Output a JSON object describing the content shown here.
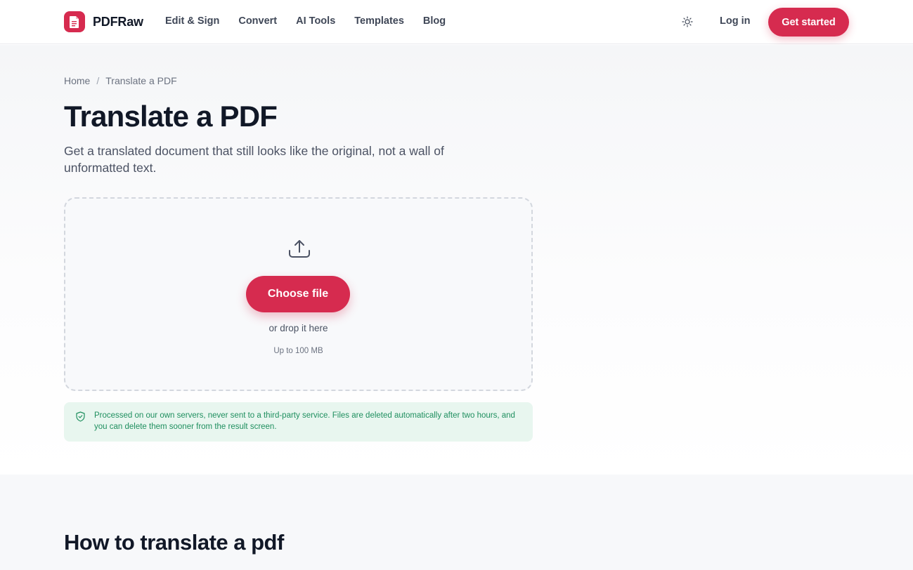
{
  "brand": {
    "name": "PDFRaw",
    "accent": "#d62b4f"
  },
  "nav": {
    "items": [
      {
        "label": "Edit & Sign"
      },
      {
        "label": "Convert"
      },
      {
        "label": "AI Tools"
      },
      {
        "label": "Templates"
      },
      {
        "label": "Blog"
      }
    ],
    "theme_icon": "sun-icon",
    "login_label": "Log in",
    "cta_label": "Get started"
  },
  "breadcrumb": {
    "home": "Home",
    "separator": "/",
    "current": "Translate a PDF"
  },
  "hero": {
    "title": "Translate a PDF",
    "subtitle": "Get a translated document that still looks like the original, not a wall of unformatted text."
  },
  "upload": {
    "icon": "upload-icon",
    "button_label": "Choose file",
    "drop_hint": "or drop it here",
    "size_limit": "Up to 100 MB"
  },
  "notice": {
    "icon": "shield-check-icon",
    "text": "Processed on our own servers, never sent to a third-party service. Files are deleted automatically after two hours, and you can delete them sooner from the result screen.",
    "color": "#1f8f5f",
    "background": "#e8f6ef"
  },
  "how_to": {
    "title": "How to translate a pdf"
  }
}
